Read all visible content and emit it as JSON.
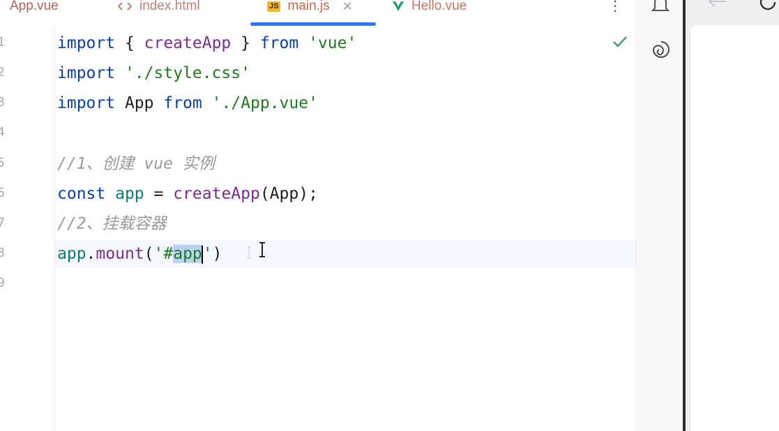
{
  "tabs": [
    {
      "label": "App.vue",
      "icon": "vue-icon"
    },
    {
      "label": "index.html",
      "icon": "html-icon"
    },
    {
      "label": "main.js",
      "icon": "js-icon",
      "badge": "JS",
      "active": true
    },
    {
      "label": "Hello.vue",
      "icon": "vue-icon"
    }
  ],
  "line_numbers": [
    "1",
    "2",
    "3",
    "4",
    "5",
    "6",
    "7",
    "8",
    "9"
  ],
  "code": {
    "l1": {
      "kw1": "import",
      "p1": " { ",
      "fn": "createApp",
      "p2": " } ",
      "kw2": "from",
      "sp": " ",
      "str": "'vue'"
    },
    "l2": {
      "kw": "import",
      "sp": " ",
      "str": "'./style.css'"
    },
    "l3": {
      "kw1": "import",
      "p1": " App ",
      "kw2": "from",
      "sp": " ",
      "str": "'./App.vue'"
    },
    "l5": {
      "comment": "//1、创建 vue 实例"
    },
    "l6": {
      "kw": "const",
      "sp1": " ",
      "var": "app",
      "p1": " = ",
      "fn": "createApp",
      "p2": "(App);"
    },
    "l7": {
      "comment": "//2、挂载容器"
    },
    "l8": {
      "var": "app",
      "p1": ".",
      "fn": "mount",
      "p2": "(",
      "str1": "'#",
      "sel": "app",
      "str2": "'",
      "p3": ")"
    }
  },
  "colors": {
    "accent": "#3574f0",
    "check": "#4a9c6d"
  }
}
